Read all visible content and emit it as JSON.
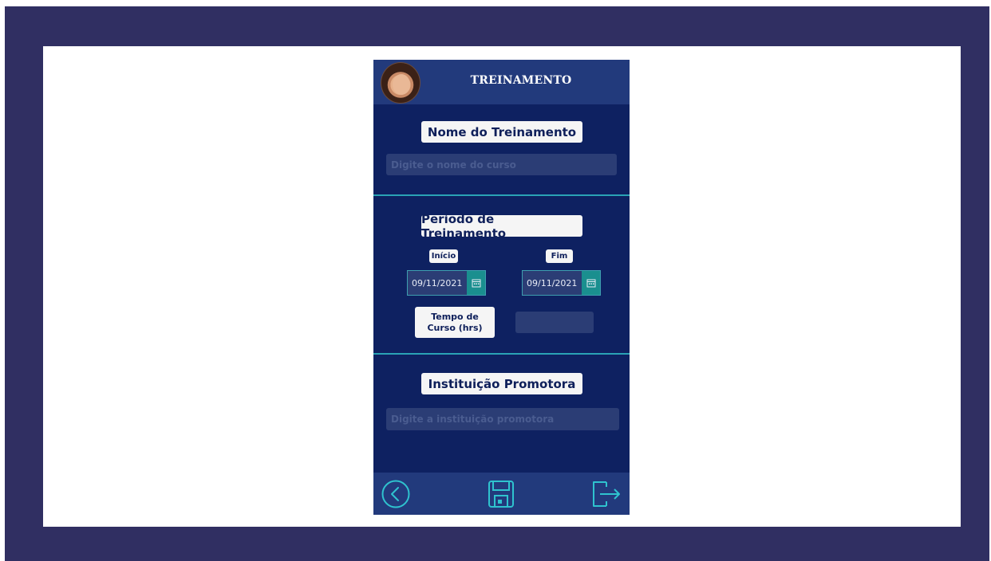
{
  "header": {
    "title": "TREINAMENTO"
  },
  "sections": {
    "nome": {
      "label": "Nome do Treinamento",
      "placeholder": "Digite o nome do curso"
    },
    "periodo": {
      "label": "Período de Treinamento",
      "inicio_label": "Início",
      "fim_label": "Fim",
      "inicio_value": "09/11/2021",
      "fim_value": "09/11/2021",
      "tempo_label_line1": "Tempo de",
      "tempo_label_line2": "Curso (hrs)",
      "tempo_value": ""
    },
    "instituicao": {
      "label": "Instituição Promotora",
      "placeholder": "Digite a instituição promotora"
    }
  },
  "icons": {
    "back": "back-circle-icon",
    "save": "save-floppy-icon",
    "exit": "exit-icon",
    "calendar": "calendar-icon"
  },
  "colors": {
    "background_frame": "#302f62",
    "phone_bg": "#0e2161",
    "bar_bg": "#223a7c",
    "accent": "#2aa3b5"
  }
}
